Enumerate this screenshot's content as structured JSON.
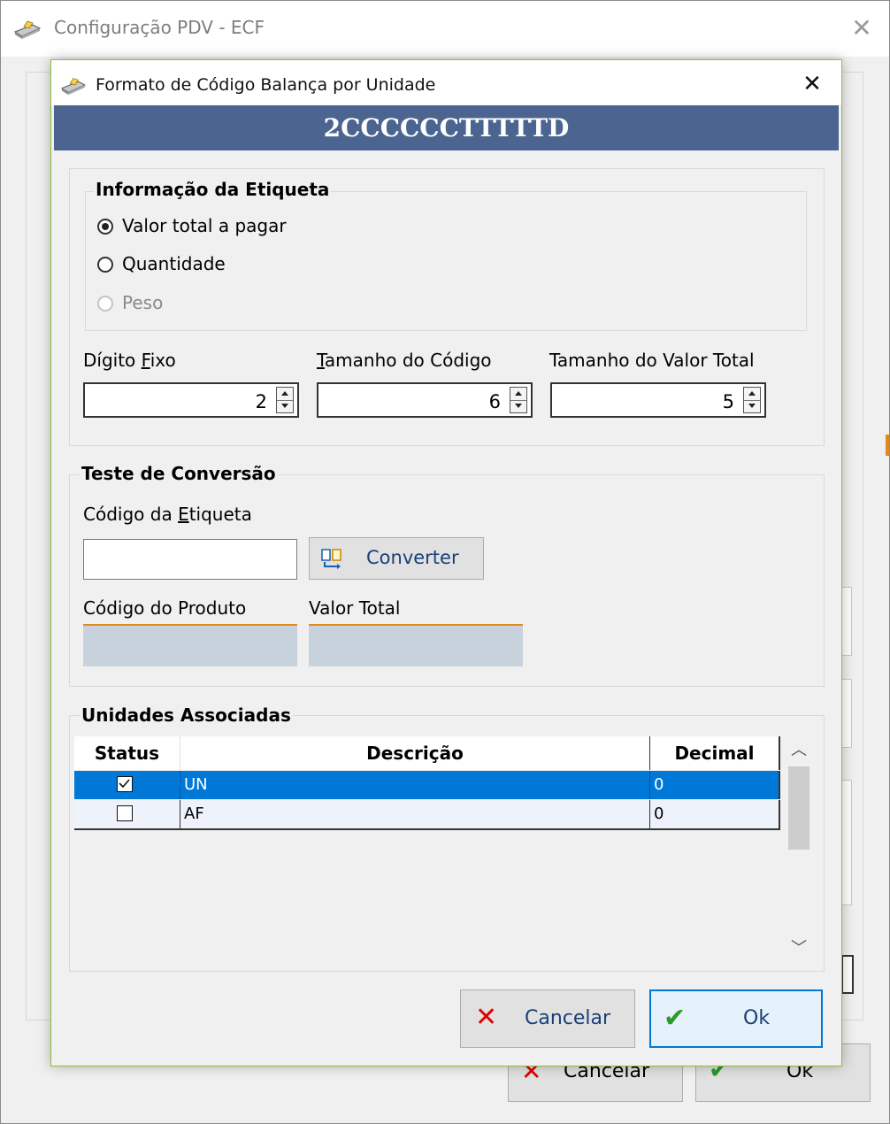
{
  "parent_window": {
    "title": "Configuração PDV - ECF",
    "close_glyph": "✕",
    "cancel_label": "Cancelar",
    "ok_label": "Ok"
  },
  "dialog": {
    "title": "Formato de Código Balança por Unidade",
    "close_glyph": "✕",
    "code_format": "2CCCCCCTTTTTD"
  },
  "label_info": {
    "legend": "Informação da Etiqueta",
    "options": [
      {
        "label": "Valor total a pagar",
        "checked": true,
        "enabled": true
      },
      {
        "label": "Quantidade",
        "checked": false,
        "enabled": true
      },
      {
        "label": "Peso",
        "checked": false,
        "enabled": false
      }
    ]
  },
  "fields": {
    "fixed_digit": {
      "label_pre": "Dígito ",
      "label_acc": "F",
      "label_post": "ixo",
      "value": "2"
    },
    "code_size": {
      "label_pre": "",
      "label_acc": "T",
      "label_post": "amanho do Código",
      "value": "6"
    },
    "total_size": {
      "label_pre": "",
      "label_acc": "",
      "label_post": "Tamanho do Valor Total",
      "value": "5"
    }
  },
  "conversion_test": {
    "legend": "Teste de Conversão",
    "label_code_pre": "Código da ",
    "label_code_acc": "E",
    "label_code_post": "tiqueta",
    "input_value": "",
    "convert_label": "Converter",
    "product_code_label": "Código do Produto",
    "total_value_label": "Valor Total",
    "product_code_value": "",
    "total_value_value": ""
  },
  "units": {
    "legend": "Unidades Associadas",
    "columns": [
      "Status",
      "Descrição",
      "Decimal"
    ],
    "rows": [
      {
        "checked": true,
        "description": "UN",
        "decimal": "0",
        "selected": true
      },
      {
        "checked": false,
        "description": "AF",
        "decimal": "0",
        "selected": false
      }
    ]
  },
  "footer": {
    "cancel_label": "Cancelar",
    "ok_label": "Ok"
  },
  "colors": {
    "banner": "#4b6590",
    "selected_row": "#0078d7",
    "cancel_x": "#e00000",
    "ok_check": "#2a9a2a",
    "accent_border": "#e08a1e"
  }
}
